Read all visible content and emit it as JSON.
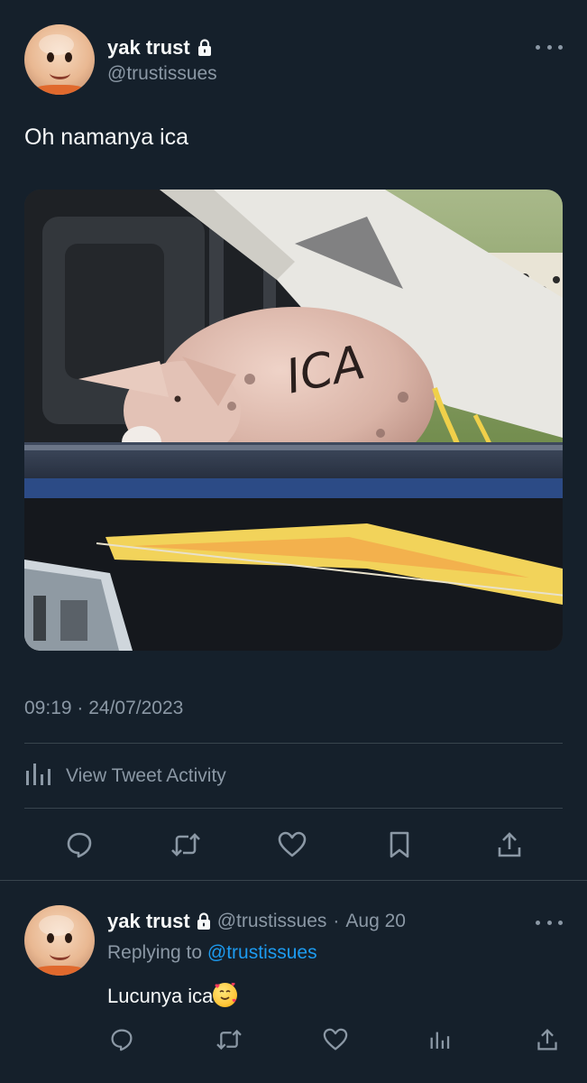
{
  "tweet": {
    "author_name": "yak trust",
    "author_handle": "@trustissues",
    "text": "Oh namanya ica",
    "image_text": "ICA",
    "timestamp": "09:19 · 24/07/2023",
    "activity_label": "View Tweet Activity"
  },
  "reply": {
    "author_name": "yak trust",
    "author_handle": "@trustissues",
    "separator": "·",
    "date": "Aug 20",
    "replying_prefix": "Replying to",
    "replying_mention": "@trustissues",
    "text": "Lucunya ica"
  },
  "icons": {
    "verified_lock": "lock-icon",
    "more": "more-icon",
    "reply": "comment-icon",
    "retweet": "retweet-icon",
    "like": "heart-icon",
    "bookmark": "bookmark-icon",
    "share": "share-icon",
    "analytics": "analytics-icon",
    "emoji": "smiling-face-with-hearts"
  },
  "colors": {
    "background": "#15202b",
    "primary_text": "#f7f9f9",
    "secondary_text": "#8b98a5",
    "divider": "#38444d",
    "link": "#1d9bf0"
  }
}
